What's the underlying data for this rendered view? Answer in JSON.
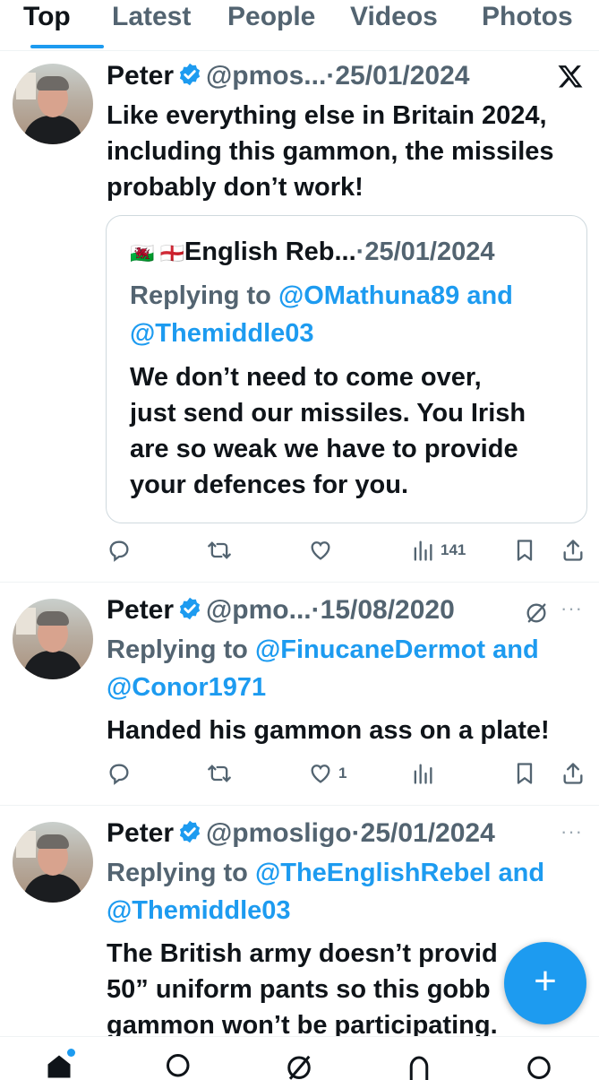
{
  "tabs": {
    "items": [
      "Top",
      "Latest",
      "People",
      "Videos",
      "Photos"
    ]
  },
  "tweets": [
    {
      "name": "Peter",
      "handle": "@pmos...",
      "separator": "·",
      "date": "25/01/2024",
      "text_lines": [
        "Like everything else in Britain 2024,",
        "including this gammon, the missiles",
        "probably don’t work!"
      ],
      "quote": {
        "flags": "🏴󠁧󠁢󠁷󠁬󠁳󠁿 🏴󠁧󠁢󠁥󠁮󠁧󠁿",
        "name": "English Reb...",
        "separator": "·",
        "date": "25/01/2024",
        "replying_prefix": "Replying to ",
        "replying_user1": "@OMathuna89",
        "replying_and": " and",
        "replying_user2": "@Themiddle03",
        "text_lines": [
          "We don’t need to come over,",
          "just send our missiles. You Irish",
          "are so weak we have to provide",
          "your defences for you."
        ]
      },
      "likes": "",
      "views": "141"
    },
    {
      "name": "Peter",
      "handle": "@pmo...",
      "separator": "·",
      "date": "15/08/2020",
      "replying_prefix": "Replying to ",
      "replying_user1": "@FinucaneDermot",
      "replying_and": " and",
      "replying_user2": "@Conor1971",
      "text_lines": [
        "Handed his gammon ass on a plate!"
      ],
      "likes": "1",
      "views": ""
    },
    {
      "name": "Peter",
      "handle": "@pmosligo",
      "separator": "·",
      "date": "25/01/2024",
      "replying_prefix": "Replying to ",
      "replying_user1": "@TheEnglishRebel",
      "replying_and": " and",
      "replying_user2": "@Themiddle03",
      "text_lines": [
        "The British army doesn’t provid",
        "50” uniform pants so this gobb",
        "gammon won’t be participating."
      ]
    }
  ],
  "more_icon": "···",
  "compose_button": "+",
  "colors": {
    "accent": "#1d9bf0",
    "text": "#0f1419",
    "secondary": "#536471"
  }
}
